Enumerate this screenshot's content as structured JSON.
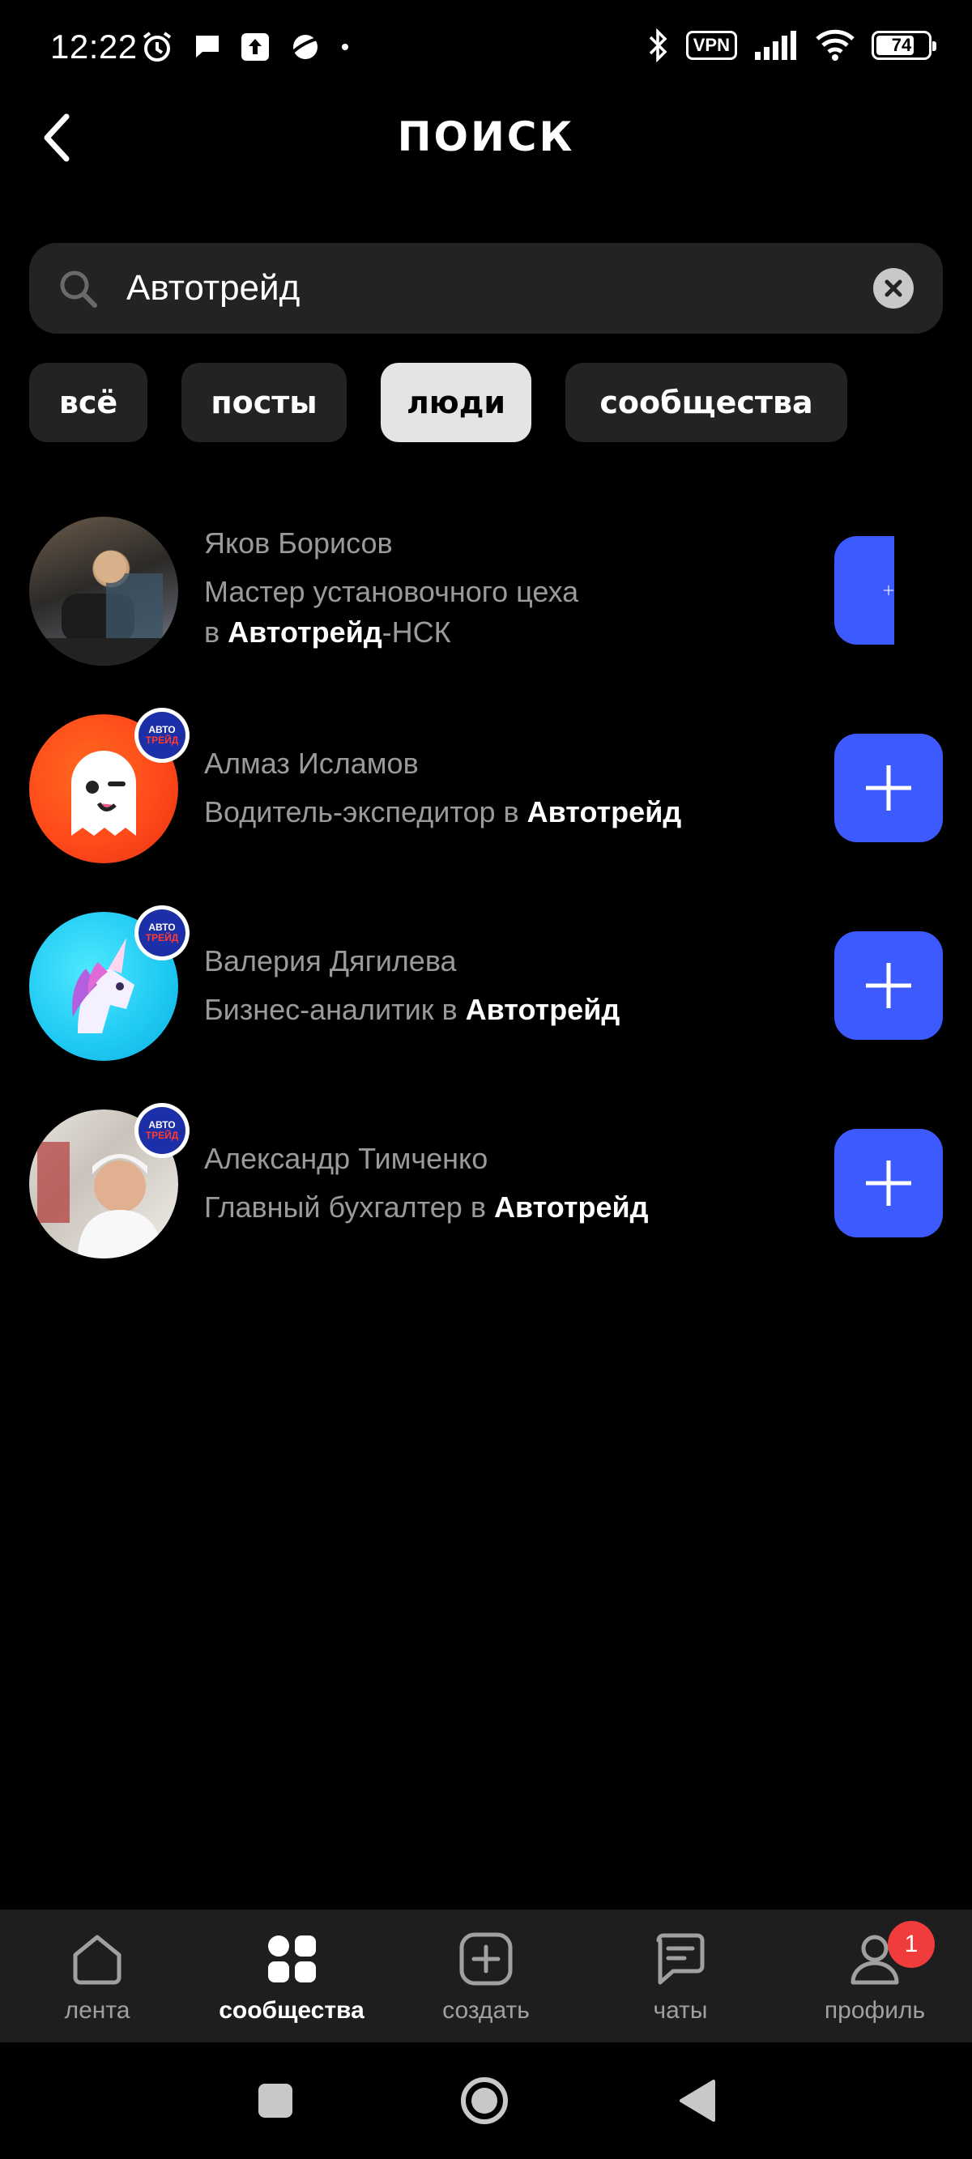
{
  "status_bar": {
    "time": "12:22",
    "vpn": "VPN",
    "battery": "74",
    "battery_level": 0.74
  },
  "header": {
    "title": "ПОИСК"
  },
  "search": {
    "value": "Автотрейд"
  },
  "filters": {
    "all": "всё",
    "posts": "посты",
    "people": "люди",
    "communities": "сообщества",
    "active": "people"
  },
  "badge_text": {
    "line1": "АВТО",
    "line2": "ТРЕЙД"
  },
  "results": [
    {
      "name": "Яков Борисов",
      "role_line1": "Мастер установочного цеха",
      "role_prefix2": "в ",
      "company": "Автотрейд",
      "suffix": "-НСК"
    },
    {
      "name": "Алмаз Исламов",
      "role": "Водитель-экспедитор в ",
      "company": "Автотрейд"
    },
    {
      "name": "Валерия Дягилева",
      "role": "Бизнес-аналитик в ",
      "company": "Автотрейд"
    },
    {
      "name": "Александр Тимченко",
      "role": "Главный бухгалтер в ",
      "company": "Автотрейд"
    }
  ],
  "bottom_nav": {
    "feed": "лента",
    "communities": "сообщества",
    "create": "создать",
    "chats": "чаты",
    "profile": "профиль",
    "profile_badge": "1"
  },
  "colors": {
    "accent": "#3d5afe",
    "badge_red": "#f03c3c",
    "background": "#000000"
  }
}
